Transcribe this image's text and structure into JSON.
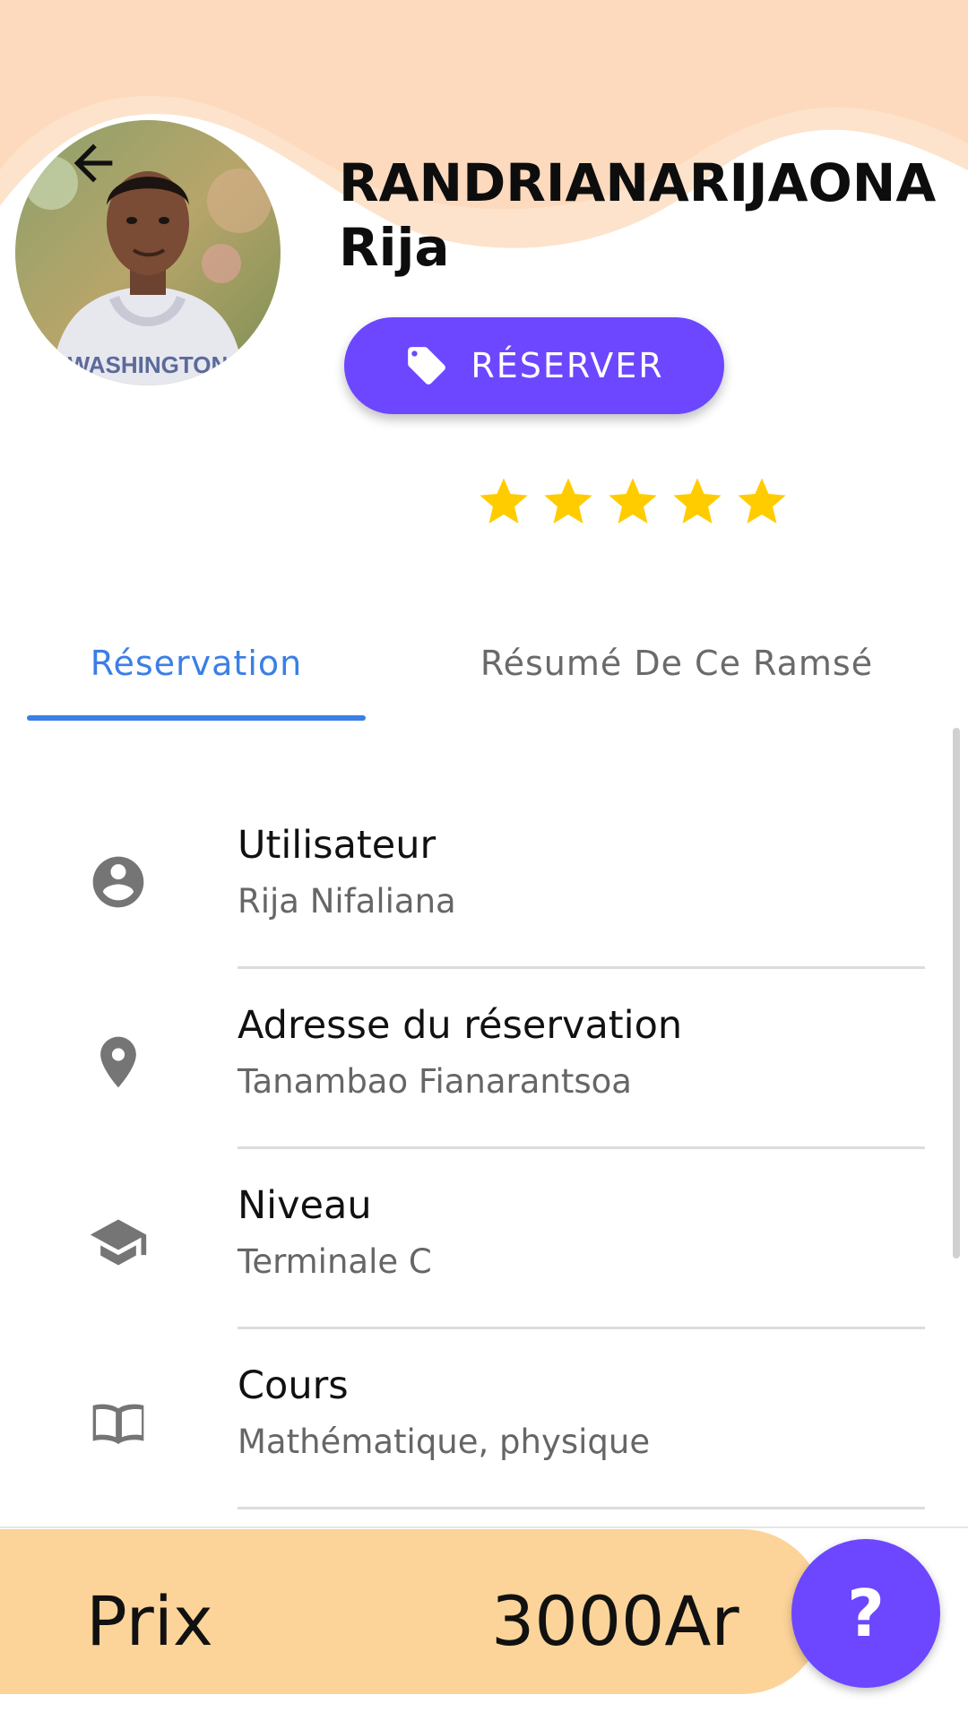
{
  "header": {
    "last_name": "RANDRIANARIJAONA",
    "first_name": "Rija",
    "back_icon": "arrow-left-icon",
    "avatar_icon": "profile-photo",
    "colors": {
      "wave": "#fdd9bb",
      "accent": "#6c47ff"
    }
  },
  "reserve_button": {
    "label": "RÉSERVER",
    "icon": "tag-icon"
  },
  "rating": {
    "value": 5,
    "max": 5,
    "color": "#ffcc00"
  },
  "tabs": [
    {
      "label": "Réservation",
      "active": true
    },
    {
      "label": "Résumé De Ce Ramsé",
      "active": false
    }
  ],
  "details": [
    {
      "icon": "account-circle-icon",
      "title": "Utilisateur",
      "value": "Rija Nifaliana"
    },
    {
      "icon": "location-pin-icon",
      "title": "Adresse du réservation",
      "value": "Tanambao Fianarantsoa"
    },
    {
      "icon": "graduation-cap-icon",
      "title": "Niveau",
      "value": "Terminale C"
    },
    {
      "icon": "book-open-icon",
      "title": "Cours",
      "value": "Mathématique, physique"
    }
  ],
  "price": {
    "label": "Prix",
    "value": "3000Ar",
    "bar_color": "#fcd499"
  },
  "help_button": {
    "label": "?"
  }
}
